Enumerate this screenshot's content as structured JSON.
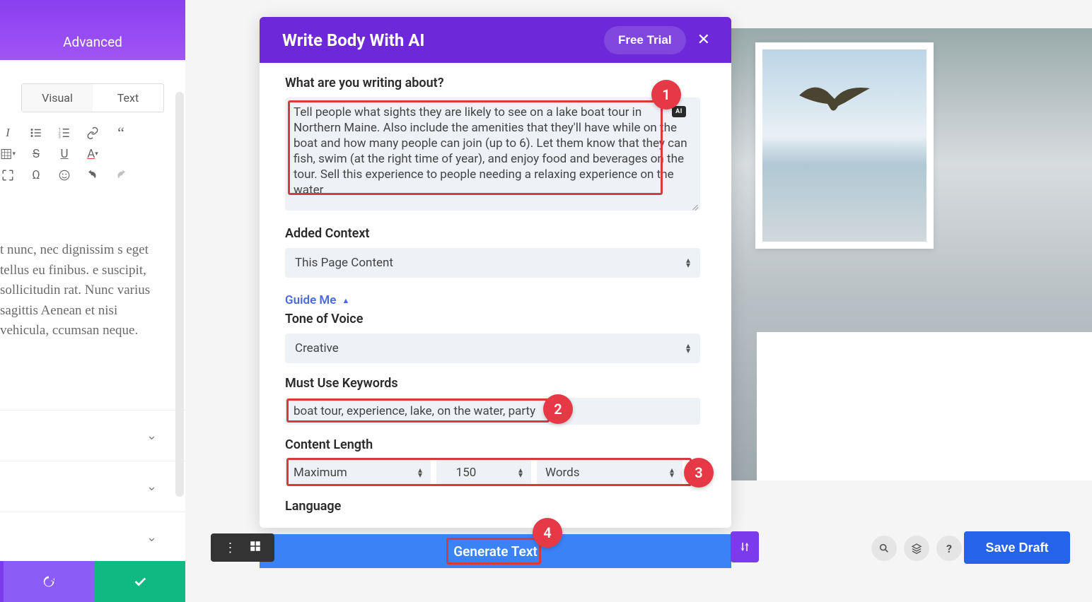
{
  "sidebar": {
    "advanced_tab": "Advanced",
    "editor_tabs": {
      "visual": "Visual",
      "text": "Text"
    },
    "body_text": "t nunc, nec dignissim s eget tellus eu finibus. e suscipit, sollicitudin rat. Nunc varius sagittis Aenean et nisi vehicula, ccumsan neque."
  },
  "modal": {
    "title": "Write Body With AI",
    "free_trial": "Free Trial",
    "ai_badge": "AI",
    "labels": {
      "prompt": "What are you writing about?",
      "context": "Added Context",
      "guide_me": "Guide Me",
      "tone": "Tone of Voice",
      "keywords": "Must Use Keywords",
      "length": "Content Length",
      "language": "Language"
    },
    "prompt_value": "Tell people what sights they are likely to see on a lake boat tour in Northern Maine. Also include the amenities that they'll have while on the boat and how many people can join (up to 6). Let them know that they can fish, swim (at the right time of year), and enjoy food and beverages on the tour. Sell this experience to people needing a relaxing experience on the water",
    "context_value": "This Page Content",
    "tone_value": "Creative",
    "keywords_value": "boat tour, experience, lake, on the water, party",
    "length": {
      "mode": "Maximum",
      "value": "150",
      "unit": "Words"
    },
    "generate": "Generate Text"
  },
  "callouts": {
    "c1": "1",
    "c2": "2",
    "c3": "3",
    "c4": "4"
  },
  "bottom": {
    "save_draft": "Save Draft",
    "help": "?"
  }
}
